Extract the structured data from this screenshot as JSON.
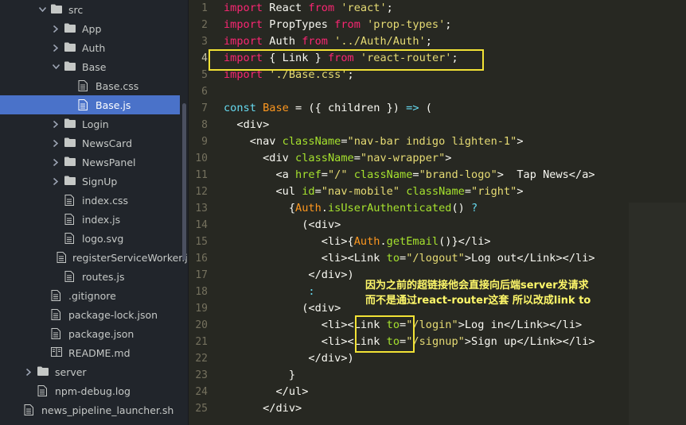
{
  "colors": {
    "sidebar_bg": "#21252b",
    "selection": "#4a72c9",
    "editor_bg": "#272822",
    "annotation": "#f2e235"
  },
  "file_tree": [
    {
      "label": "src",
      "type": "folder",
      "expanded": true,
      "depth": 2,
      "icon": "folder-icon"
    },
    {
      "label": "App",
      "type": "folder",
      "expanded": false,
      "depth": 3,
      "icon": "folder-icon"
    },
    {
      "label": "Auth",
      "type": "folder",
      "expanded": false,
      "depth": 3,
      "icon": "folder-icon"
    },
    {
      "label": "Base",
      "type": "folder",
      "expanded": true,
      "depth": 3,
      "icon": "folder-icon"
    },
    {
      "label": "Base.css",
      "type": "file",
      "depth": 4,
      "icon": "file-icon"
    },
    {
      "label": "Base.js",
      "type": "file",
      "depth": 4,
      "icon": "file-icon",
      "selected": true
    },
    {
      "label": "Login",
      "type": "folder",
      "expanded": false,
      "depth": 3,
      "icon": "folder-icon"
    },
    {
      "label": "NewsCard",
      "type": "folder",
      "expanded": false,
      "depth": 3,
      "icon": "folder-icon"
    },
    {
      "label": "NewsPanel",
      "type": "folder",
      "expanded": false,
      "depth": 3,
      "icon": "folder-icon"
    },
    {
      "label": "SignUp",
      "type": "folder",
      "expanded": false,
      "depth": 3,
      "icon": "folder-icon"
    },
    {
      "label": "index.css",
      "type": "file",
      "depth": 3,
      "icon": "file-icon"
    },
    {
      "label": "index.js",
      "type": "file",
      "depth": 3,
      "icon": "file-icon"
    },
    {
      "label": "logo.svg",
      "type": "file",
      "depth": 3,
      "icon": "file-icon"
    },
    {
      "label": "registerServiceWorker.js",
      "type": "file",
      "depth": 3,
      "icon": "file-icon"
    },
    {
      "label": "routes.js",
      "type": "file",
      "depth": 3,
      "icon": "file-icon"
    },
    {
      "label": ".gitignore",
      "type": "file",
      "depth": 2,
      "icon": "file-icon"
    },
    {
      "label": "package-lock.json",
      "type": "file",
      "depth": 2,
      "icon": "file-icon"
    },
    {
      "label": "package.json",
      "type": "file",
      "depth": 2,
      "icon": "file-icon"
    },
    {
      "label": "README.md",
      "type": "file",
      "depth": 2,
      "icon": "book-icon"
    },
    {
      "label": "server",
      "type": "folder",
      "expanded": false,
      "depth": 1,
      "icon": "folder-icon"
    },
    {
      "label": "npm-debug.log",
      "type": "file",
      "depth": 1,
      "icon": "file-icon"
    },
    {
      "label": "news_pipeline_launcher.sh",
      "type": "file",
      "depth": 0,
      "icon": "file-icon"
    }
  ],
  "editor": {
    "current_line": 4,
    "lines": [
      {
        "n": "1",
        "tokens": [
          [
            "k",
            "import"
          ],
          [
            "i",
            " React "
          ],
          [
            "k",
            "from"
          ],
          [
            "s",
            " 'react'"
          ],
          [
            "p",
            ";"
          ]
        ]
      },
      {
        "n": "2",
        "tokens": [
          [
            "k",
            "import"
          ],
          [
            "i",
            " PropTypes "
          ],
          [
            "k",
            "from"
          ],
          [
            "s",
            " 'prop-types'"
          ],
          [
            "p",
            ";"
          ]
        ]
      },
      {
        "n": "3",
        "tokens": [
          [
            "k",
            "import"
          ],
          [
            "i",
            " Auth "
          ],
          [
            "k",
            "from"
          ],
          [
            "s",
            " '../Auth/Auth'"
          ],
          [
            "p",
            ";"
          ]
        ]
      },
      {
        "n": "4",
        "tokens": [
          [
            "k",
            "import"
          ],
          [
            "p",
            " { "
          ],
          [
            "i",
            "Link"
          ],
          [
            "p",
            " } "
          ],
          [
            "k",
            "from"
          ],
          [
            "s",
            " 'react-router'"
          ],
          [
            "p",
            ";"
          ]
        ]
      },
      {
        "n": "5",
        "tokens": [
          [
            "k",
            "import"
          ],
          [
            "s",
            " './Base.css'"
          ],
          [
            "p",
            ";"
          ]
        ]
      },
      {
        "n": "6",
        "tokens": []
      },
      {
        "n": "7",
        "tokens": [
          [
            "b",
            "const"
          ],
          [
            "v",
            " Base"
          ],
          [
            "p",
            " = ({ children }) "
          ],
          [
            "b",
            "=>"
          ],
          [
            "p",
            " ("
          ]
        ]
      },
      {
        "n": "8",
        "tokens": [
          [
            "p",
            "  <"
          ],
          [
            "i",
            "div"
          ],
          [
            "p",
            ">"
          ]
        ]
      },
      {
        "n": "9",
        "tokens": [
          [
            "p",
            "    <"
          ],
          [
            "i",
            "nav"
          ],
          [
            "a",
            " className"
          ],
          [
            "p",
            "="
          ],
          [
            "s",
            "\"nav-bar indigo lighten-1\""
          ],
          [
            "p",
            ">"
          ]
        ]
      },
      {
        "n": "10",
        "tokens": [
          [
            "p",
            "      <"
          ],
          [
            "i",
            "div"
          ],
          [
            "a",
            " className"
          ],
          [
            "p",
            "="
          ],
          [
            "s",
            "\"nav-wrapper\""
          ],
          [
            "p",
            ">"
          ]
        ]
      },
      {
        "n": "11",
        "tokens": [
          [
            "p",
            "        <"
          ],
          [
            "i",
            "a"
          ],
          [
            "a",
            " href"
          ],
          [
            "p",
            "="
          ],
          [
            "s",
            "\"/\""
          ],
          [
            "a",
            " className"
          ],
          [
            "p",
            "="
          ],
          [
            "s",
            "\"brand-logo\""
          ],
          [
            "p",
            ">  Tap News</"
          ],
          [
            "i",
            "a"
          ],
          [
            "p",
            ">"
          ]
        ]
      },
      {
        "n": "12",
        "tokens": [
          [
            "p",
            "        <"
          ],
          [
            "i",
            "ul"
          ],
          [
            "a",
            " id"
          ],
          [
            "p",
            "="
          ],
          [
            "s",
            "\"nav-mobile\""
          ],
          [
            "a",
            " className"
          ],
          [
            "p",
            "="
          ],
          [
            "s",
            "\"right\""
          ],
          [
            "p",
            ">"
          ]
        ]
      },
      {
        "n": "13",
        "tokens": [
          [
            "p",
            "          {"
          ],
          [
            "v",
            "Auth"
          ],
          [
            "p",
            "."
          ],
          [
            "a",
            "isUserAuthenticated"
          ],
          [
            "p",
            "() "
          ],
          [
            "b",
            "?"
          ]
        ]
      },
      {
        "n": "14",
        "tokens": [
          [
            "p",
            "            (<"
          ],
          [
            "i",
            "div"
          ],
          [
            "p",
            ">"
          ]
        ]
      },
      {
        "n": "15",
        "tokens": [
          [
            "p",
            "               <"
          ],
          [
            "i",
            "li"
          ],
          [
            "p",
            ">{"
          ],
          [
            "v",
            "Auth"
          ],
          [
            "p",
            "."
          ],
          [
            "a",
            "getEmail"
          ],
          [
            "p",
            "()}</"
          ],
          [
            "i",
            "li"
          ],
          [
            "p",
            ">"
          ]
        ]
      },
      {
        "n": "16",
        "tokens": [
          [
            "p",
            "               <"
          ],
          [
            "i",
            "li"
          ],
          [
            "p",
            "><"
          ],
          [
            "i",
            "Link"
          ],
          [
            "a",
            " to"
          ],
          [
            "p",
            "="
          ],
          [
            "s",
            "\"/logout\""
          ],
          [
            "p",
            ">Log out</"
          ],
          [
            "i",
            "Link"
          ],
          [
            "p",
            "></"
          ],
          [
            "i",
            "li"
          ],
          [
            "p",
            ">"
          ]
        ]
      },
      {
        "n": "17",
        "tokens": [
          [
            "p",
            "             </"
          ],
          [
            "i",
            "div"
          ],
          [
            "p",
            ">)"
          ]
        ]
      },
      {
        "n": "18",
        "tokens": [
          [
            "p",
            "             "
          ],
          [
            "b",
            ":"
          ]
        ]
      },
      {
        "n": "19",
        "tokens": [
          [
            "p",
            "            (<"
          ],
          [
            "i",
            "div"
          ],
          [
            "p",
            ">"
          ]
        ]
      },
      {
        "n": "20",
        "tokens": [
          [
            "p",
            "               <"
          ],
          [
            "i",
            "li"
          ],
          [
            "p",
            "><"
          ],
          [
            "i",
            "Link"
          ],
          [
            "a",
            " to"
          ],
          [
            "p",
            "="
          ],
          [
            "s",
            "\"/login\""
          ],
          [
            "p",
            ">Log in</"
          ],
          [
            "i",
            "Link"
          ],
          [
            "p",
            "></"
          ],
          [
            "i",
            "li"
          ],
          [
            "p",
            ">"
          ]
        ]
      },
      {
        "n": "21",
        "tokens": [
          [
            "p",
            "               <"
          ],
          [
            "i",
            "li"
          ],
          [
            "p",
            "><"
          ],
          [
            "i",
            "Link"
          ],
          [
            "a",
            " to"
          ],
          [
            "p",
            "="
          ],
          [
            "s",
            "\"/signup\""
          ],
          [
            "p",
            ">Sign up</"
          ],
          [
            "i",
            "Link"
          ],
          [
            "p",
            "></"
          ],
          [
            "i",
            "li"
          ],
          [
            "p",
            ">"
          ]
        ]
      },
      {
        "n": "22",
        "tokens": [
          [
            "p",
            "             </"
          ],
          [
            "i",
            "div"
          ],
          [
            "p",
            ">)"
          ]
        ]
      },
      {
        "n": "23",
        "tokens": [
          [
            "p",
            "          }"
          ]
        ]
      },
      {
        "n": "24",
        "tokens": [
          [
            "p",
            "        </"
          ],
          [
            "i",
            "ul"
          ],
          [
            "p",
            ">"
          ]
        ]
      },
      {
        "n": "25",
        "tokens": [
          [
            "p",
            "      </"
          ],
          [
            "i",
            "div"
          ],
          [
            "p",
            ">"
          ]
        ]
      }
    ]
  },
  "annotation": {
    "line1": "因为之前的超链接他会直接向后端server发请求",
    "line2": "而不是通过react-router这套 所以改成link to"
  }
}
